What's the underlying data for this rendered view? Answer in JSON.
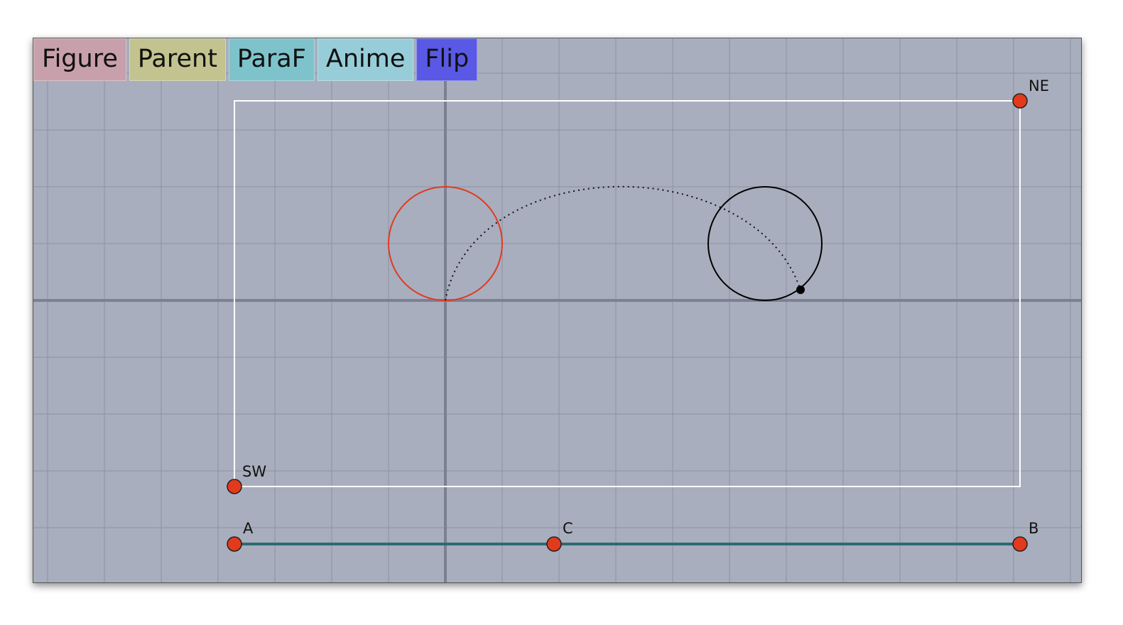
{
  "toolbar": {
    "buttons": [
      {
        "label": "Figure",
        "color": "#c8a0ab"
      },
      {
        "label": "Parent",
        "color": "#c2c38f"
      },
      {
        "label": "ParaF",
        "color": "#7ec3cb"
      },
      {
        "label": "Anime",
        "color": "#97cdd8"
      },
      {
        "label": "Flip",
        "color": "#5959e6"
      }
    ]
  },
  "points": {
    "NE": "NE",
    "SW": "SW",
    "A": "A",
    "B": "B",
    "C": "C"
  },
  "colors": {
    "background": "#a8aebd",
    "grid": "#8d93a3",
    "axis": "#7b8191",
    "frame": "#ffffff",
    "red_circle": "#e03a22",
    "black_circle": "#000000",
    "point_fill": "#e23a1c",
    "segment": "#2e6b70"
  }
}
